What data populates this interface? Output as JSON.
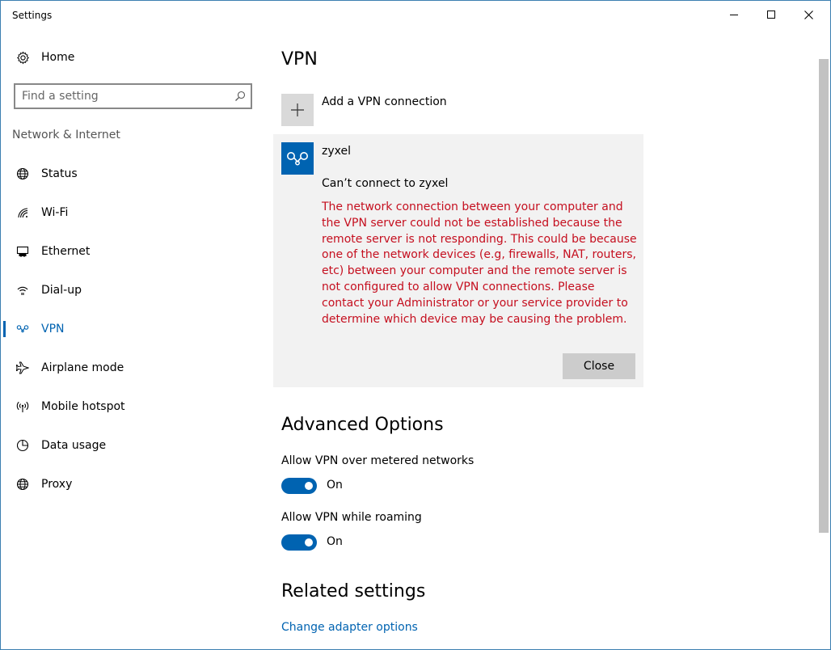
{
  "window": {
    "title": "Settings"
  },
  "sidebar": {
    "home": {
      "label": "Home",
      "icon": "gear-icon"
    },
    "search": {
      "placeholder": "Find a setting",
      "icon": "search-icon"
    },
    "section_label": "Network & Internet",
    "items": [
      {
        "label": "Status",
        "icon": "globe-icon"
      },
      {
        "label": "Wi-Fi",
        "icon": "wifi-icon"
      },
      {
        "label": "Ethernet",
        "icon": "ethernet-icon"
      },
      {
        "label": "Dial-up",
        "icon": "dial-up-icon"
      },
      {
        "label": "VPN",
        "icon": "vpn-icon",
        "active": true
      },
      {
        "label": "Airplane mode",
        "icon": "airplane-icon"
      },
      {
        "label": "Mobile hotspot",
        "icon": "hotspot-icon"
      },
      {
        "label": "Data usage",
        "icon": "pie-chart-icon"
      },
      {
        "label": "Proxy",
        "icon": "globe-icon"
      }
    ]
  },
  "main": {
    "title": "VPN",
    "add_vpn_label": "Add a VPN connection",
    "connection": {
      "name": "zyxel",
      "status": "Can’t connect to zyxel",
      "error": "The network connection between your computer and the VPN server could not be established because the remote server is not responding. This could be because one of the network devices (e.g, firewalls, NAT, routers, etc) between your computer and the remote server is not configured to allow VPN connections. Please contact your Administrator or your service provider to determine which device may be causing the problem.",
      "close_label": "Close"
    },
    "advanced": {
      "title": "Advanced Options",
      "options": [
        {
          "label": "Allow VPN over metered networks",
          "state": "On"
        },
        {
          "label": "Allow VPN while roaming",
          "state": "On"
        }
      ]
    },
    "related": {
      "title": "Related settings",
      "link": "Change adapter options"
    }
  },
  "colors": {
    "accent": "#0063b1",
    "error": "#c50f1f",
    "card_bg": "#f2f2f2"
  }
}
